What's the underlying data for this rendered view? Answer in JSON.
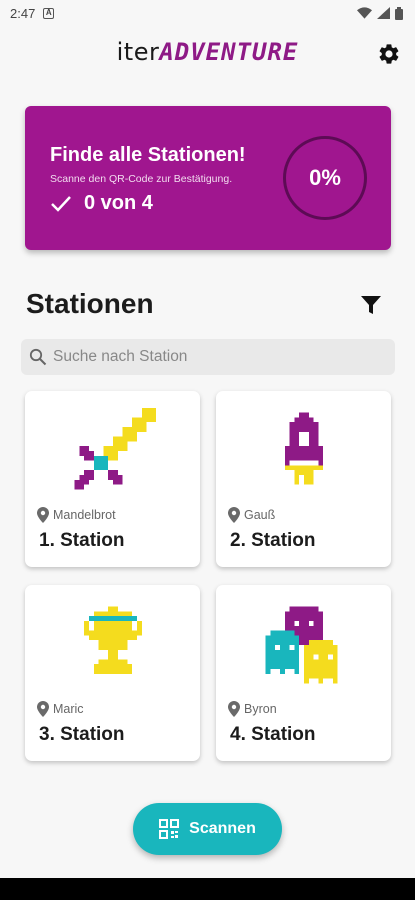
{
  "status_bar": {
    "time": "2:47",
    "notification_badge": "A",
    "icons": [
      "wifi-icon",
      "signal-icon",
      "battery-icon"
    ]
  },
  "app_bar": {
    "logo_prefix": "iter",
    "logo_suffix": "ADVENTURE",
    "settings_icon": "gear-icon"
  },
  "progress": {
    "title": "Finde alle Stationen!",
    "subtitle": "Scanne den QR-Code zur Bestätigung.",
    "count_text": "0 von 4",
    "percent_text": "0%",
    "percent_value": 0,
    "color": "#a0168f"
  },
  "stations_section": {
    "title": "Stationen",
    "filter_icon": "filter-icon"
  },
  "search": {
    "placeholder": "Suche nach Station",
    "value": ""
  },
  "stations": [
    {
      "location": "Mandelbrot",
      "name": "1. Station",
      "icon": "pixel-sword-icon"
    },
    {
      "location": "Gauß",
      "name": "2. Station",
      "icon": "pixel-rocket-icon"
    },
    {
      "location": "Maric",
      "name": "3. Station",
      "icon": "pixel-trophy-icon"
    },
    {
      "location": "Byron",
      "name": "4. Station",
      "icon": "pixel-ghosts-icon"
    }
  ],
  "scan_button": {
    "label": "Scannen",
    "icon": "qr-code-icon",
    "color": "#19b6bd"
  },
  "colors": {
    "accent": "#8e1a86",
    "pixel_yellow": "#f4dc1e",
    "pixel_purple": "#8e1a86",
    "pixel_cyan": "#19b6bd"
  }
}
